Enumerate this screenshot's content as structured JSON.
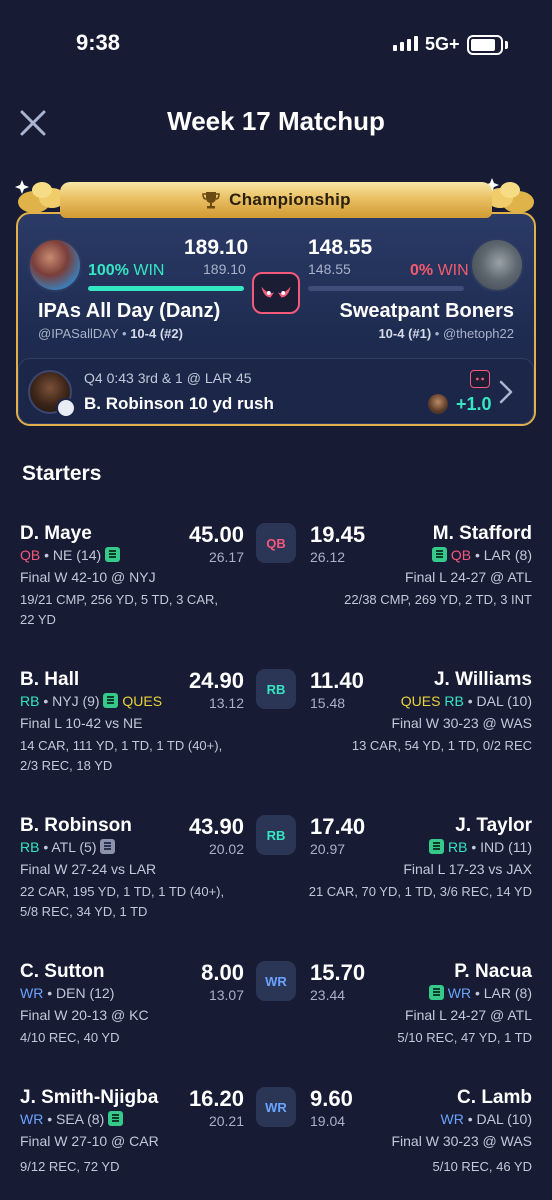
{
  "status_bar": {
    "time": "9:38",
    "network": "5G+"
  },
  "header": {
    "title": "Week 17 Matchup"
  },
  "championship": {
    "banner": "Championship",
    "colors": {
      "gold": "#e2b04a",
      "win": "#35e6c3",
      "loss": "#f35a6e"
    },
    "left_team": {
      "score": "189.10",
      "projected": "189.10",
      "win_pct": "100%",
      "win_label": "WIN",
      "name": "IPAs All Day (Danz)",
      "handle": "@IPASallDAY",
      "record": "10-4 (#2)"
    },
    "right_team": {
      "score": "148.55",
      "projected": "148.55",
      "win_pct": "0%",
      "win_label": "WIN",
      "name": "Sweatpant Boners",
      "handle": "@thetoph22",
      "record": "10-4 (#1)"
    },
    "last_play": {
      "situation": "Q4 0:43 3rd & 1 @ LAR 45",
      "description": "B. Robinson 10 yd rush",
      "points": "+1.0"
    }
  },
  "starters_label": "Starters",
  "matchups": [
    {
      "slot": "QB",
      "slot_color": "#f4587a",
      "left": {
        "name": "D. Maye",
        "pos": "QB",
        "team": "• NE (14)",
        "game": "Final W 42-10 @ NYJ",
        "stat_line1": "19/21 CMP, 256 YD, 5 TD, 3 CAR,",
        "stat_line2": "22 YD",
        "points": "45.00",
        "projected": "26.17"
      },
      "right": {
        "name": "M. Stafford",
        "pos": "QB",
        "team": "• LAR (8)",
        "game": "Final L 24-27 @ ATL",
        "stat_line1": "22/38 CMP, 269 YD, 2 TD, 3 INT",
        "points": "19.45",
        "projected": "26.12"
      }
    },
    {
      "slot": "RB",
      "slot_color": "#35e6c3",
      "left": {
        "name": "B. Hall",
        "pos": "RB",
        "team": "• NYJ (9)",
        "status": "QUES",
        "game": "Final L 10-42 vs NE",
        "stat_line1": "14 CAR, 111 YD, 1 TD, 1 TD (40+),",
        "stat_line2": "2/3 REC, 18 YD",
        "points": "24.90",
        "projected": "13.12"
      },
      "right": {
        "name": "J. Williams",
        "pos": "RB",
        "team": "• DAL (10)",
        "status": "QUES",
        "game": "Final W 30-23 @ WAS",
        "stat_line1": "13 CAR, 54 YD, 1 TD, 0/2 REC",
        "points": "11.40",
        "projected": "15.48"
      }
    },
    {
      "slot": "RB",
      "slot_color": "#35e6c3",
      "left": {
        "name": "B. Robinson",
        "pos": "RB",
        "team": "• ATL (5)",
        "game": "Final W 27-24 vs LAR",
        "stat_line1": "22 CAR, 195 YD, 1 TD, 1 TD (40+),",
        "stat_line2": "5/8 REC, 34 YD, 1 TD",
        "points": "43.90",
        "projected": "20.02"
      },
      "right": {
        "name": "J. Taylor",
        "pos": "RB",
        "team": "• IND (11)",
        "game": "Final L 17-23 vs JAX",
        "stat_line1": "21 CAR, 70 YD, 1 TD, 3/6 REC, 14 YD",
        "points": "17.40",
        "projected": "20.97"
      }
    },
    {
      "slot": "WR",
      "slot_color": "#6aa3ff",
      "left": {
        "name": "C. Sutton",
        "pos": "WR",
        "team": "• DEN (12)",
        "game": "Final W 20-13 @ KC",
        "stat_line1": "4/10 REC, 40 YD",
        "points": "8.00",
        "projected": "13.07"
      },
      "right": {
        "name": "P. Nacua",
        "pos": "WR",
        "team": "• LAR (8)",
        "game": "Final L 24-27 @ ATL",
        "stat_line1": "5/10 REC, 47 YD, 1 TD",
        "points": "15.70",
        "projected": "23.44"
      }
    },
    {
      "slot": "WR",
      "slot_color": "#6aa3ff",
      "left": {
        "name": "J. Smith-Njigba",
        "pos": "WR",
        "team": "• SEA (8)",
        "game": "Final W 27-10 @ CAR",
        "stat_line1": "9/12 REC, 72 YD",
        "points": "16.20",
        "projected": "20.21"
      },
      "right": {
        "name": "C. Lamb",
        "pos": "WR",
        "team": "• DAL (10)",
        "game": "Final W 30-23 @ WAS",
        "stat_line1": "5/10 REC, 46 YD",
        "points": "9.60",
        "projected": "19.04"
      }
    }
  ]
}
